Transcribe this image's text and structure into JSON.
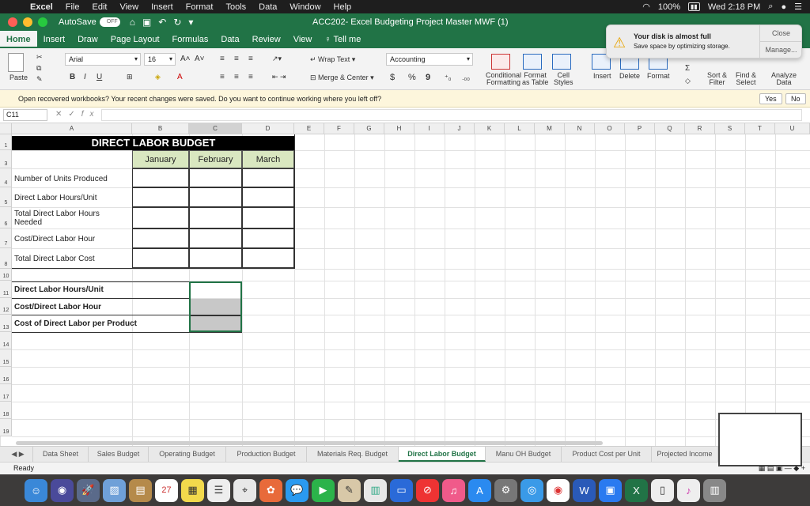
{
  "menubar": {
    "app": "Excel",
    "items": [
      "File",
      "Edit",
      "View",
      "Insert",
      "Format",
      "Tools",
      "Data",
      "Window",
      "Help"
    ],
    "battery": "100%",
    "clock": "Wed 2:18 PM"
  },
  "window": {
    "autosave_label": "AutoSave",
    "autosave_state": "OFF",
    "title": "ACC202- Excel Budgeting Project Master MWF (1)"
  },
  "ribbon_tabs": [
    "Home",
    "Insert",
    "Draw",
    "Page Layout",
    "Formulas",
    "Data",
    "Review",
    "View",
    "Tell me"
  ],
  "ribbon": {
    "paste": "Paste",
    "font_name": "Arial",
    "font_size": "16",
    "bold": "B",
    "italic": "I",
    "underline": "U",
    "wrap_text": "Wrap Text",
    "merge_center": "Merge & Center",
    "number_format": "Accounting",
    "currency": "$",
    "percent": "%",
    "comma": "9",
    "conditional_formatting": [
      "Conditional",
      "Formatting"
    ],
    "format_as_table": [
      "Format",
      "as Table"
    ],
    "cell_styles": [
      "Cell",
      "Styles"
    ],
    "insert": "Insert",
    "delete": "Delete",
    "format": "Format",
    "sort_filter": [
      "Sort &",
      "Filter"
    ],
    "find_select": [
      "Find &",
      "Select"
    ],
    "analyze_data": [
      "Analyze",
      "Data"
    ]
  },
  "notification": {
    "title": "Your disk is almost full",
    "body": "Save space by optimizing storage.",
    "close": "Close",
    "manage": "Manage..."
  },
  "recovery": {
    "message": "Open recovered workbooks?  Your recent changes were saved. Do you want to continue working where you left off?",
    "yes": "Yes",
    "no": "No"
  },
  "formula_bar": {
    "name_box": "C11",
    "fx": "fx",
    "formula": ""
  },
  "columns": [
    "A",
    "B",
    "C",
    "D",
    "E",
    "F",
    "G",
    "H",
    "I",
    "J",
    "K",
    "L",
    "M",
    "N",
    "O",
    "P",
    "Q",
    "R",
    "S",
    "T",
    "U"
  ],
  "selected_column": "C",
  "rows": [
    "1",
    "3",
    "4",
    "5",
    "6",
    "7",
    "8",
    "10",
    "11",
    "12",
    "13",
    "14",
    "15",
    "16",
    "17",
    "18",
    "19"
  ],
  "budget": {
    "title": "DIRECT LABOR BUDGET",
    "months": [
      "January",
      "February",
      "March"
    ],
    "line_items": [
      "Number of Units Produced",
      "Direct Labor Hours/Unit",
      "Total Direct Labor Hours Needed",
      "Cost/Direct Labor Hour",
      "Total Direct Labor Cost"
    ],
    "summary_items": [
      "Direct Labor Hours/Unit",
      "Cost/Direct Labor Hour",
      "Cost of Direct Labor per Product"
    ]
  },
  "sheet_tabs": [
    "Data Sheet",
    "Sales Budget",
    "Operating Budget",
    "Production Budget",
    "Materials Req. Budget",
    "Direct Labor Budget",
    "Manu OH Budget",
    "Product Cost per Unit",
    "Projected Income"
  ],
  "active_sheet": "Direct Labor Budget",
  "status": "Ready",
  "dock_badge": "27"
}
